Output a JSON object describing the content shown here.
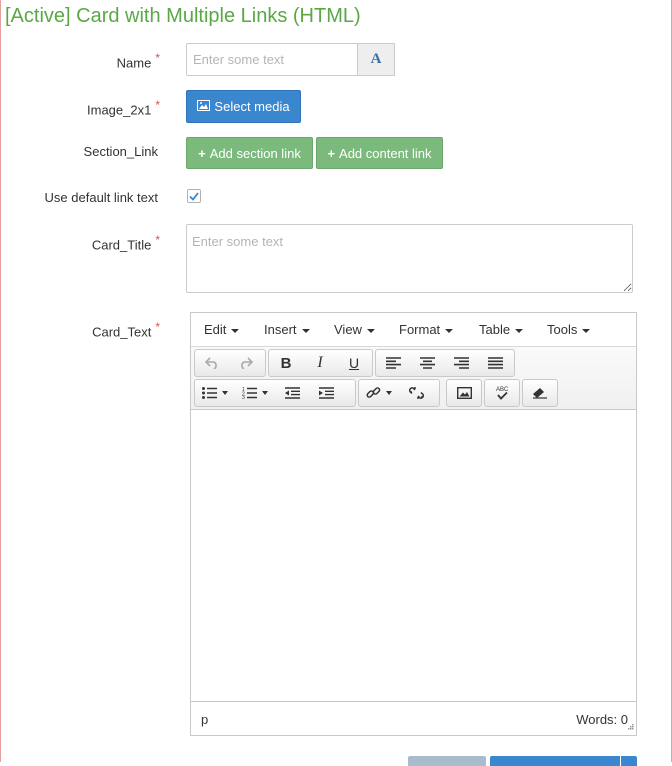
{
  "form": {
    "title": "[Active] Card with Multiple Links (HTML)",
    "required_mark": "*",
    "fields": {
      "name": {
        "label": "Name",
        "placeholder": "Enter some text",
        "addon": "A"
      },
      "image": {
        "label": "Image_2x1",
        "button": "Select media"
      },
      "section_link": {
        "label": "Section_Link",
        "add_section": "Add section link",
        "add_content": "Add content link"
      },
      "use_default": {
        "label": "Use default link text",
        "checked": true
      },
      "card_title": {
        "label": "Card_Title",
        "placeholder": "Enter some text"
      },
      "card_text": {
        "label": "Card_Text"
      }
    }
  },
  "editor": {
    "menu": [
      "Edit",
      "Insert",
      "View",
      "Format",
      "Table",
      "Tools"
    ],
    "toolbar_icons": [
      "undo-icon",
      "redo-icon",
      "bold-icon",
      "italic-icon",
      "underline-icon",
      "align-left-icon",
      "align-center-icon",
      "align-right-icon",
      "align-justify-icon",
      "bullet-list-icon",
      "numbered-list-icon",
      "outdent-icon",
      "indent-icon",
      "link-icon",
      "unlink-icon",
      "image-icon",
      "spellcheck-icon",
      "eraser-icon"
    ],
    "bold_glyph": "B",
    "italic_glyph": "I",
    "underline_glyph": "U",
    "status_path": "p",
    "word_count": "Words: 0"
  },
  "colors": {
    "title": "#5aa845",
    "primary": "#3a87cf",
    "success": "#7bb97c",
    "required": "#d9534f"
  }
}
